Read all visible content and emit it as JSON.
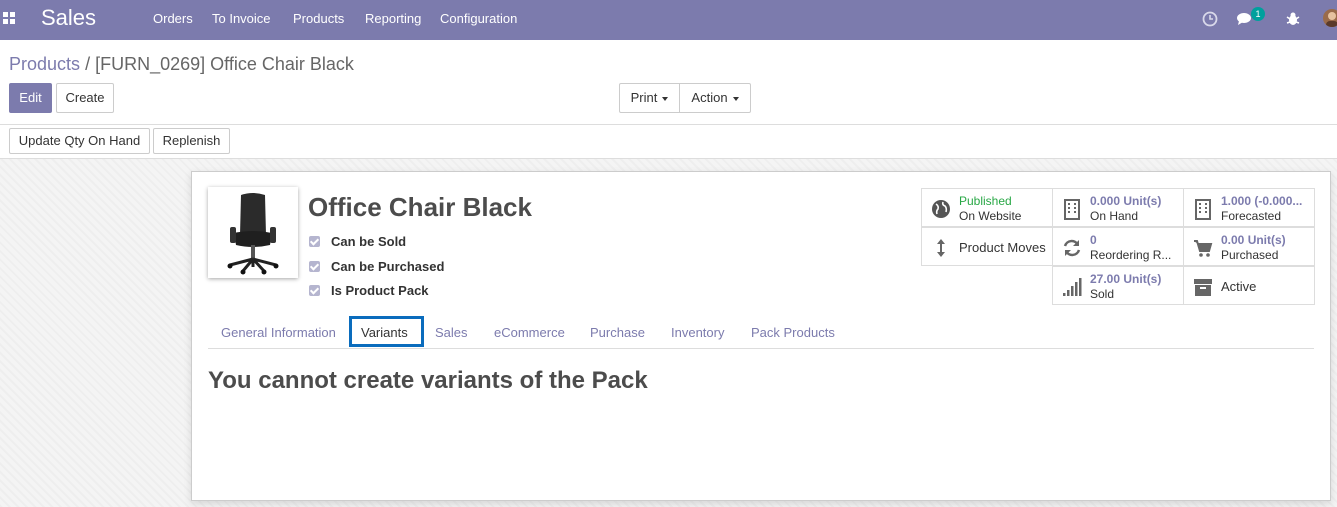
{
  "navbar": {
    "brand": "Sales",
    "menu": [
      "Orders",
      "To Invoice",
      "Products",
      "Reporting",
      "Configuration"
    ],
    "messages_count": "1",
    "color": "#7c7bad"
  },
  "breadcrumb": {
    "parent": "Products",
    "separator": "/",
    "current": "[FURN_0269] Office Chair Black"
  },
  "buttons": {
    "edit": "Edit",
    "create": "Create",
    "print": "Print",
    "action": "Action",
    "update_qty": "Update Qty On Hand",
    "replenish": "Replenish"
  },
  "product": {
    "name": "Office Chair Black",
    "checks": [
      {
        "label": "Can be Sold",
        "checked": true
      },
      {
        "label": "Can be Purchased",
        "checked": true
      },
      {
        "label": "Is Product Pack",
        "checked": true
      }
    ]
  },
  "stats": {
    "website": {
      "line1": "Published",
      "line2": "On Website",
      "icon": "globe-icon"
    },
    "on_hand": {
      "value": "0.000 Unit(s)",
      "label": "On Hand",
      "icon": "building-icon"
    },
    "forecasted": {
      "value": "1.000 (-0.000...",
      "label": "Forecasted",
      "icon": "building-icon"
    },
    "moves": {
      "label": "Product Moves",
      "icon": "arrows-v-icon"
    },
    "reordering": {
      "value": "0",
      "label": "Reordering R...",
      "icon": "refresh-icon"
    },
    "purchased": {
      "value": "0.00 Unit(s)",
      "label": "Purchased",
      "icon": "cart-icon"
    },
    "sold": {
      "value": "27.00 Unit(s)",
      "label": "Sold",
      "icon": "signal-icon"
    },
    "active": {
      "label": "Active",
      "icon": "archive-icon"
    }
  },
  "tabs": [
    "General Information",
    "Variants",
    "Sales",
    "eCommerce",
    "Purchase",
    "Inventory",
    "Pack Products"
  ],
  "active_tab": "Variants",
  "variants_notice": "You cannot create variants of the Pack"
}
